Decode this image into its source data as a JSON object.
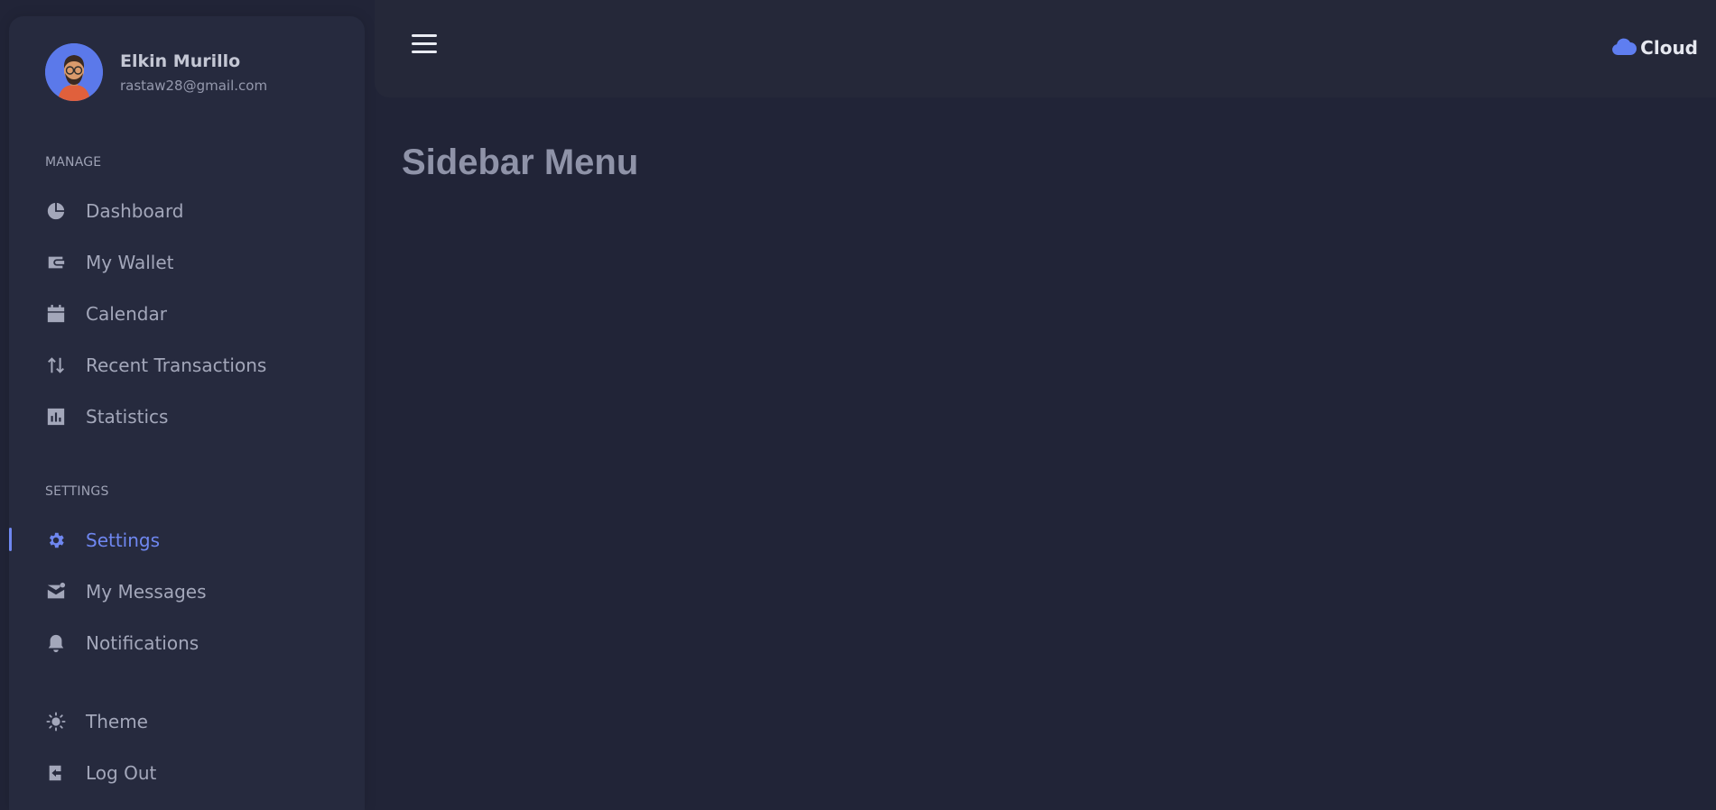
{
  "profile": {
    "name": "Elkin Murillo",
    "email": "rastaw28@gmail.com"
  },
  "sections": {
    "manage": "MANAGE",
    "settings": "SETTINGS"
  },
  "menu": {
    "dashboard": "Dashboard",
    "wallet": "My Wallet",
    "calendar": "Calendar",
    "transactions": "Recent Transactions",
    "statistics": "Statistics",
    "settings": "Settings",
    "messages": "My Messages",
    "notifications": "Notifications",
    "theme": "Theme",
    "logout": "Log Out"
  },
  "active_item": "Settings",
  "brand": {
    "label": "Cloud",
    "icon": "cloud-icon"
  },
  "page": {
    "title": "Sidebar Menu"
  },
  "colors": {
    "accent": "#6f87f0",
    "background": "#212437",
    "sidebar": "#262a3e"
  }
}
